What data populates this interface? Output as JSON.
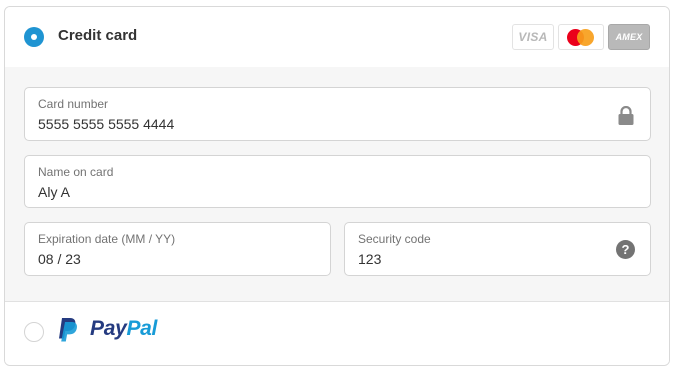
{
  "credit_card": {
    "label": "Credit card",
    "selected": true,
    "brands": [
      {
        "name": "VISA",
        "icon": "visa-logo"
      },
      {
        "name": "Mastercard",
        "icon": "mastercard-logo"
      },
      {
        "name": "AMEX",
        "icon": "amex-logo"
      }
    ],
    "fields": {
      "card_number": {
        "label": "Card number",
        "value": "5555 5555 5555 4444",
        "icon": "lock-icon"
      },
      "name_on_card": {
        "label": "Name on card",
        "value": "Aly A"
      },
      "expiration": {
        "label": "Expiration date (MM / YY)",
        "value": "08 / 23"
      },
      "security_code": {
        "label": "Security code",
        "value": "123",
        "help_glyph": "?"
      }
    }
  },
  "paypal": {
    "part1": "Pay",
    "part2": "Pal",
    "selected": false
  },
  "colors": {
    "accent": "#1f94d2",
    "paypal_dark": "#253b80",
    "paypal_light": "#179bd7",
    "body_bg": "#f6f6f6"
  }
}
